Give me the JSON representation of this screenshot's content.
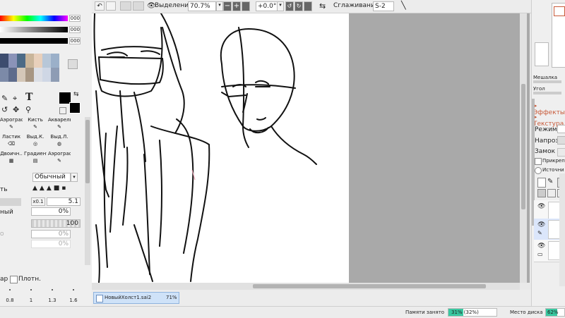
{
  "toolbar": {
    "selection_label": "Выделение",
    "zoom_value": "70.7%",
    "rotation_value": "+0.0°",
    "smoothing_label": "Сглаживание",
    "smoothing_value": "S-2"
  },
  "left": {
    "tool_labels": [
      "Аэрограф",
      "Кисть",
      "Акварель",
      "Ластик",
      "Выд.К.",
      "Выд.Л.",
      "Двоичн..",
      "Градиент",
      "Аэрограф"
    ],
    "blend_mode": "Обычный",
    "brush_size_label": "ть",
    "size_multiplier": "x0.1",
    "size_value": "5.1",
    "density_label": "ный",
    "density_value": "0%",
    "opacity_value": "100",
    "hidden_value": "0%",
    "extra_value": "0%",
    "airbrush_label": "ар",
    "dense_label": "Плотн.",
    "presets": [
      "0.8",
      "1",
      "1.3",
      "1.6"
    ]
  },
  "right": {
    "mixer_label": "Мешалка",
    "angle_label": "Угол",
    "effects_label": "Эффекты",
    "texture_label": "Текстура",
    "mode_label": "Режим",
    "opacity_label": "Напроз.",
    "lock_label": "Замок",
    "clip_label": "Прикреп",
    "source_label": "Источни"
  },
  "document_tab": {
    "name": "НовыйХолст1.sai2",
    "zoom": "71%"
  },
  "statusbar": {
    "memory_label": "Памяти занято",
    "memory_value": "31% (32%)",
    "memory_fraction": 0.31,
    "disk_label": "Место диска",
    "disk_value": "62%",
    "disk_fraction": 0.62
  },
  "colors": {
    "memory_fill": "#38c8a0",
    "disk_fill": "#38c8a0",
    "tab_bg": "#cfe2f8",
    "accent_red": "#c85a3a"
  }
}
